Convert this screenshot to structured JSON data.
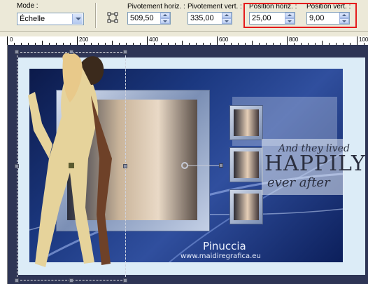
{
  "toolbar": {
    "mode_label": "Mode :",
    "mode_value": "Échelle",
    "pivot_h_label": "Pivotement horiz. :",
    "pivot_h_value": "509,50",
    "pivot_v_label": "Pivotement vert. :",
    "pivot_v_value": "335,00",
    "pos_h_label": "Position horiz. :",
    "pos_h_value": "25,00",
    "pos_v_label": "Position vert. :",
    "pos_v_value": "9,00"
  },
  "ruler": {
    "labels": [
      "0",
      "200",
      "400",
      "600",
      "800",
      "1000"
    ]
  },
  "canvas": {
    "tagline_top": "And they lived",
    "tagline_main": "HAPPILY",
    "tagline_bottom": "ever after",
    "signature": "Pinuccia",
    "website": "www.maidiregrafica.eu"
  },
  "colors": {
    "highlight": "#e51b1b",
    "workspace": "#2e3555",
    "panel": "#1b3880"
  }
}
